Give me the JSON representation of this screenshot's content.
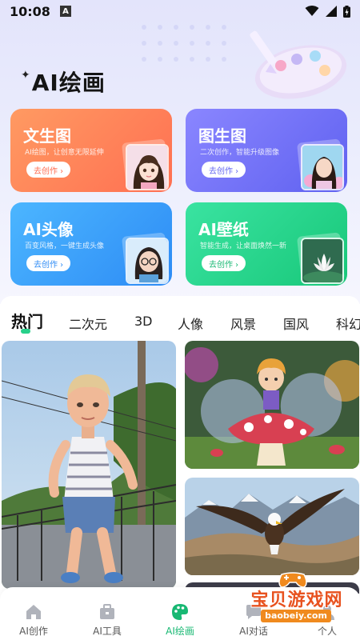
{
  "status_bar": {
    "time": "10:08",
    "app_indicator": "A",
    "icons": [
      "wifi-icon",
      "signal-icon",
      "battery-icon"
    ]
  },
  "page": {
    "title": "AI绘画"
  },
  "feature_cards": [
    {
      "title": "文生图",
      "subtitle": "AI绘图，让创意无限延伸",
      "button": "去创作 ›",
      "color": "#ff7a55"
    },
    {
      "title": "图生图",
      "subtitle": "二次创作，智能升级图像",
      "button": "去创作 ›",
      "color": "#6366f1"
    },
    {
      "title": "AI头像",
      "subtitle": "百变风格，一键生成头像",
      "button": "去创作 ›",
      "color": "#2d8bf5"
    },
    {
      "title": "AI壁纸",
      "subtitle": "智能生成，让桌面焕然一新",
      "button": "去创作 ›",
      "color": "#18b873"
    }
  ],
  "categories": [
    "热门",
    "二次元",
    "3D",
    "人像",
    "风景",
    "国风",
    "科幻"
  ],
  "active_category": "热门",
  "gallery": [
    {
      "subject": "3d-runner-girl"
    },
    {
      "subject": "fairy-on-mushroom"
    },
    {
      "subject": "eagle-over-mountains"
    }
  ],
  "bottom_nav": [
    {
      "label": "AI创作",
      "icon": "home-icon"
    },
    {
      "label": "AI工具",
      "icon": "toolbox-icon"
    },
    {
      "label": "AI绘画",
      "icon": "palette-icon"
    },
    {
      "label": "AI对话",
      "icon": "chat-icon"
    },
    {
      "label": "个人",
      "icon": "user-icon"
    }
  ],
  "active_nav": "AI绘画",
  "watermark": {
    "text": "宝贝游戏网",
    "domain": "baobeiy.com"
  },
  "colors": {
    "accent": "#18b873",
    "header_bg": "#e3e4fb"
  }
}
